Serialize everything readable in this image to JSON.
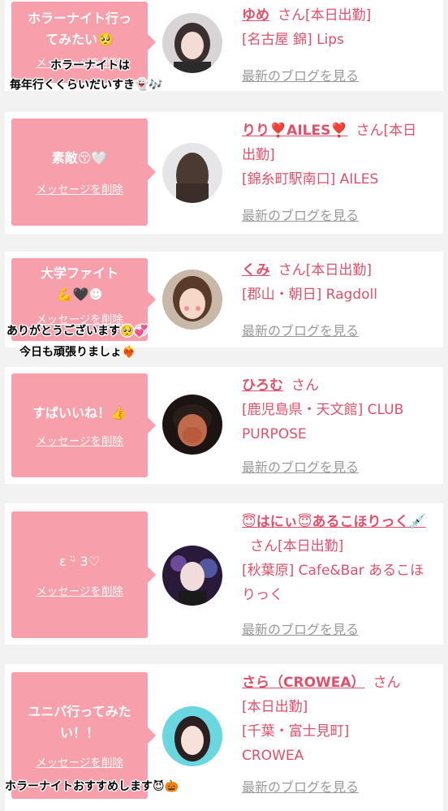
{
  "entries": [
    {
      "message": "ホラーナイト行ってみたい🥺",
      "delete_label": "メッセージを削除",
      "name": "ゆめ",
      "san": "さん",
      "shift": "[本日出勤]",
      "location": "[名古屋 錦] Lips",
      "blog_label": "最新のブログを見る",
      "overlay": [
        "ホラーナイトは",
        "毎年行くくらいだいすき👻🎶"
      ]
    },
    {
      "message": "素敵😚🤍",
      "delete_label": "メッセージを削除",
      "name": "りり❣️AILES❣️",
      "san": "さん",
      "shift": "[本日出勤]",
      "location": "[錦糸町駅南口] AILES",
      "blog_label": "最新のブログを見る"
    },
    {
      "message": "大学ファイト💪🖤☻",
      "delete_label": "メッセージを削除",
      "name": "くみ",
      "san": "さん",
      "shift": "[本日出勤]",
      "location": "[郡山・朝日] Ragdoll",
      "blog_label": "最新のブログを見る",
      "overlay": [
        "ありがとうございます🥺💞",
        "今日も頑張りましょ❤️‍🔥"
      ]
    },
    {
      "message": "すばいいね！👍",
      "delete_label": "メッセージを削除",
      "name": "ひろむ",
      "san": "さん",
      "shift": "",
      "location": "[鹿児島県・天文館] CLUB PURPOSE",
      "blog_label": "最新のブログを見る"
    },
    {
      "message": "ε ᵕ̈ 3♡",
      "delete_label": "メッセージを削除",
      "name": "😇はにぃ😇あるこほりっく💉",
      "san": "さん",
      "shift": "[本日出勤]",
      "location": "[秋葉原] Cafe&Bar あるこほりっく",
      "blog_label": "最新のブログを見る"
    },
    {
      "message": "ユニバ行ってみたい！！",
      "delete_label": "メッセージを削除",
      "name": "さら（CROWEA）",
      "san": "さん",
      "shift": "[本日出勤]",
      "location": "[千葉・富士見町] CROWEA",
      "blog_label": "最新のブログを見る",
      "overlay": [
        "ホラーナイトおすすめします😈🎃"
      ]
    }
  ]
}
